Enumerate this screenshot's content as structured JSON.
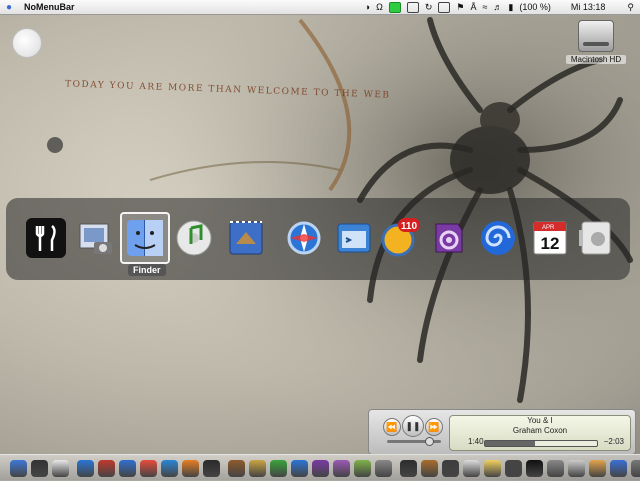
{
  "menubar": {
    "app_name": "NoMenuBar",
    "battery": "(100 %)",
    "clock": "Mi 13:18"
  },
  "desktop": {
    "tagline": "Today you are more than welcome to the web",
    "drive_label": "Macintosh HD"
  },
  "switcher": {
    "selected_label": "Finder",
    "apps": [
      {
        "name": "fork-knife-icon",
        "color": "#111111"
      },
      {
        "name": "iphoto-icon",
        "color": "#7a98c8"
      },
      {
        "name": "finder-icon",
        "color": "#3d78d8"
      },
      {
        "name": "itunes-icon",
        "color": "#3aa33a"
      },
      {
        "name": "mail-icon",
        "color": "#3e6fc7"
      },
      {
        "name": "safari-icon",
        "color": "#2a75d6"
      },
      {
        "name": "browser-window-icon",
        "color": "#3c83d6"
      },
      {
        "name": "chat-badge-icon",
        "color": "#f3b21f"
      },
      {
        "name": "colorsync-icon",
        "color": "#7a3aa4"
      },
      {
        "name": "nautilus-icon",
        "color": "#2268d8"
      },
      {
        "name": "ical-icon",
        "color": "#ffffff"
      },
      {
        "name": "apple-switch-icon",
        "color": "#dddddd"
      }
    ],
    "ical_month": "APR",
    "ical_day": "12",
    "chat_badge": "110"
  },
  "player": {
    "track": "You & I",
    "artist": "Graham Coxon",
    "elapsed": "1:40",
    "remaining": "−2:03",
    "progress": 0.45
  }
}
